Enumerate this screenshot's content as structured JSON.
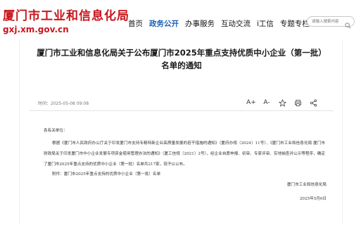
{
  "site": {
    "title": "厦门市工业和信息化局",
    "domain": "gxj.xm.gov.cn"
  },
  "nav": {
    "items": [
      {
        "label": "首页",
        "active": false
      },
      {
        "label": "政务公开",
        "active": true
      },
      {
        "label": "办事服务",
        "active": false
      },
      {
        "label": "互动交流",
        "active": false
      },
      {
        "label": "i工信",
        "active": false
      },
      {
        "label": "专题专栏",
        "active": false
      }
    ]
  },
  "search": {
    "placeholder": "请输入搜索内容",
    "icon": "search-icon"
  },
  "article": {
    "title": "厦门市工业和信息化局关于公布厦门市2025年重点支持优质中小企业（第一批）名单的通知",
    "time": "时间：2025-05-08 09:08",
    "tools": [
      {
        "label": "A+",
        "icon": "font-increase-icon"
      },
      {
        "label": "A-",
        "icon": "font-decrease-icon"
      },
      {
        "label": "",
        "icon": "star-icon"
      },
      {
        "label": "",
        "icon": "print-icon"
      },
      {
        "label": "",
        "icon": "share-icon"
      }
    ],
    "salutation": "各有关单位：",
    "paragraph": "根据《厦门市人民政府办公厅关于印发厦门市支持专精特新企业高质量发展的若干措施的通知》（厦府办规〔2024〕11号）、《厦门市工业和信息化局 厦门市财政局关于印发厦门市中小企业发展专项资金使用管理办法的通知》（厦工信规〔2021〕2号），经企业自愿申报、初审、专家评审、实地抽查并公示等程序，确定了厦门市2025年重点支持的优质中小企业（第一批）名单共217家，现予以公布。",
    "attachment": "附件：厦门市2025年重点支持的优质中小企业（第一批）名单",
    "signature": "厦门市工业和信息化局",
    "sign_date": "2025年5月6日"
  },
  "colors": {
    "brand_red": "#c8161d",
    "nav_active": "#1b5fb5"
  }
}
